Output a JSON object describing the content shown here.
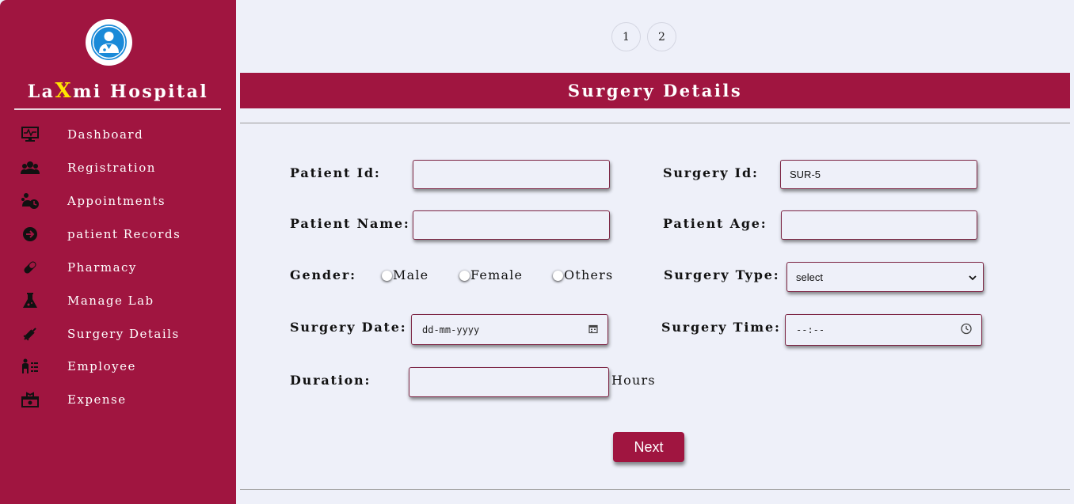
{
  "sidebar": {
    "brand_prefix": "La",
    "brand_x": "X",
    "brand_suffix": "mi Hospital",
    "logo_icon": "doctor-avatar-icon",
    "items": [
      {
        "label": "Dashboard",
        "icon": "monitor-icon"
      },
      {
        "label": "Registration",
        "icon": "users-icon"
      },
      {
        "label": "Appointments",
        "icon": "user-clock-icon"
      },
      {
        "label": "patient Records",
        "icon": "arrow-circle-icon"
      },
      {
        "label": "Pharmacy",
        "icon": "pill-icon"
      },
      {
        "label": "Manage Lab",
        "icon": "flask-icon"
      },
      {
        "label": "Surgery Details",
        "icon": "syringe-icon"
      },
      {
        "label": "Employee",
        "icon": "employee-list-icon"
      },
      {
        "label": "Expense",
        "icon": "expense-icon"
      }
    ]
  },
  "pagination": [
    "1",
    "2"
  ],
  "page_title": "Surgery Details",
  "form": {
    "patient_id_label": "Patient Id:",
    "patient_id_value": "",
    "surgery_id_label": "Surgery Id:",
    "surgery_id_value": "SUR-5",
    "patient_name_label": "Patient Name:",
    "patient_name_value": "",
    "patient_age_label": "Patient Age:",
    "patient_age_value": "",
    "gender_label": "Gender:",
    "gender_options": [
      "Male",
      "Female",
      "Others"
    ],
    "surgery_type_label": "Surgery Type:",
    "surgery_type_value": "select",
    "surgery_date_label": "Surgery Date:",
    "surgery_date_placeholder": "dd-mm-yyyy",
    "surgery_time_label": "Surgery Time:",
    "surgery_time_placeholder": "--:--",
    "duration_label": "Duration:",
    "duration_value": "",
    "duration_unit": "Hours",
    "next_label": "Next"
  },
  "colors": {
    "primary": "#a01540",
    "accent": "#ffe600",
    "background": "#eef0f9"
  }
}
